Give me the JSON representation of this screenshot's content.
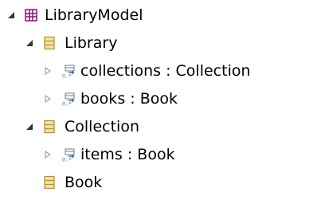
{
  "tree": {
    "root": {
      "label": "LibraryModel",
      "icon": "package-icon",
      "expanded": true
    },
    "classes": [
      {
        "label": "Library",
        "icon": "class-icon",
        "expanded": true,
        "references": [
          {
            "label": "collections : Collection",
            "icon": "reference-icon",
            "expanded": false
          },
          {
            "label": "books : Book",
            "icon": "reference-icon",
            "expanded": false
          }
        ]
      },
      {
        "label": "Collection",
        "icon": "class-icon",
        "expanded": true,
        "references": [
          {
            "label": "items : Book",
            "icon": "reference-icon",
            "expanded": false
          }
        ]
      },
      {
        "label": "Book",
        "icon": "class-icon",
        "expanded": false,
        "references": []
      }
    ]
  },
  "colors": {
    "package": "#8e1b8e",
    "class_fill": "#f4e2a8",
    "class_stroke": "#b8962a",
    "twisty_expanded": "#333333",
    "twisty_collapsed": "#9a9a9a",
    "reference_blue": "#2f6fb8"
  }
}
